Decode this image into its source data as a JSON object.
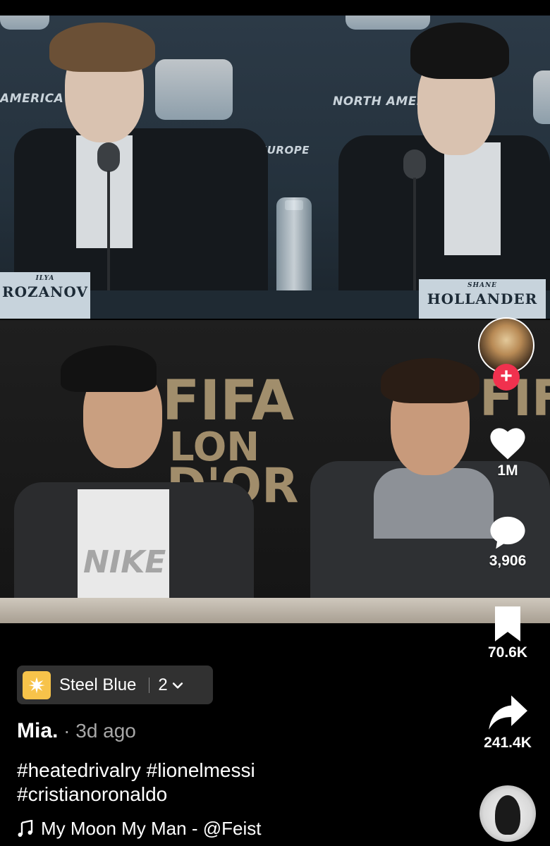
{
  "video": {
    "top_frame": {
      "backdrop_texts": [
        "AMERICA",
        "NORTH AMERICA",
        "EUROPE"
      ],
      "left_nameplate": {
        "small": "ILYA",
        "big": "ROZANOV"
      },
      "right_nameplate": {
        "small": "SHANE",
        "big": "HOLLANDER"
      }
    },
    "bottom_frame": {
      "backdrop_left": "FIFA",
      "backdrop_left_sub": "LON",
      "backdrop_left_sub2": "D'OR",
      "backdrop_right": "FIF",
      "shirt_text": "NIKE"
    }
  },
  "rail": {
    "follow_symbol": "+",
    "likes": "1M",
    "comments": "3,906",
    "saves": "70.6K",
    "shares": "241.4K"
  },
  "series": {
    "name": "Steel Blue",
    "count": "2"
  },
  "post": {
    "author": "Mia.",
    "meta": " · 3d ago",
    "caption_line1": "#heatedrivalry #lionelmessi",
    "caption_line2": "#cristianoronaldo",
    "music": "My Moon My Man - @Feist"
  },
  "colors": {
    "follow": "#f0314e",
    "series_icon": "#f7c34a",
    "background": "#000000"
  },
  "icons": [
    "heart-icon",
    "comment-icon",
    "bookmark-icon",
    "share-icon",
    "music-note-icon",
    "chevron-down-icon",
    "plus-icon"
  ]
}
